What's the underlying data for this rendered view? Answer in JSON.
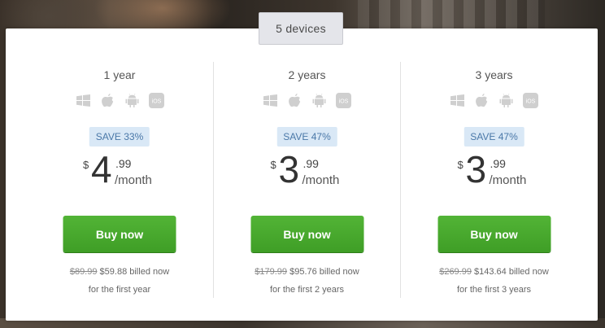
{
  "device_tab": {
    "label": "5 devices"
  },
  "plans": [
    {
      "term": "1 year",
      "save": "SAVE 33%",
      "currency": "$",
      "dollars": "4",
      "cents": ".99",
      "per": "/month",
      "buy_label": "Buy now",
      "old_price": "$89.99",
      "billed": "$59.88 billed now",
      "period_note": "for the first year"
    },
    {
      "term": "2 years",
      "save": "SAVE 47%",
      "currency": "$",
      "dollars": "3",
      "cents": ".99",
      "per": "/month",
      "buy_label": "Buy now",
      "old_price": "$179.99",
      "billed": "$95.76 billed now",
      "period_note": "for the first 2 years"
    },
    {
      "term": "3 years",
      "save": "SAVE 47%",
      "currency": "$",
      "dollars": "3",
      "cents": ".99",
      "per": "/month",
      "buy_label": "Buy now",
      "old_price": "$269.99",
      "billed": "$143.64 billed now",
      "period_note": "for the first 3 years"
    }
  ],
  "os_icons": [
    "windows-icon",
    "apple-icon",
    "android-icon",
    "ios-icon"
  ],
  "ios_text": "iOS",
  "colors": {
    "buy_button": "#4aab30",
    "save_badge_bg": "#d9e8f6",
    "save_badge_text": "#4a78a8",
    "icon_gray": "#cfcfcf"
  }
}
